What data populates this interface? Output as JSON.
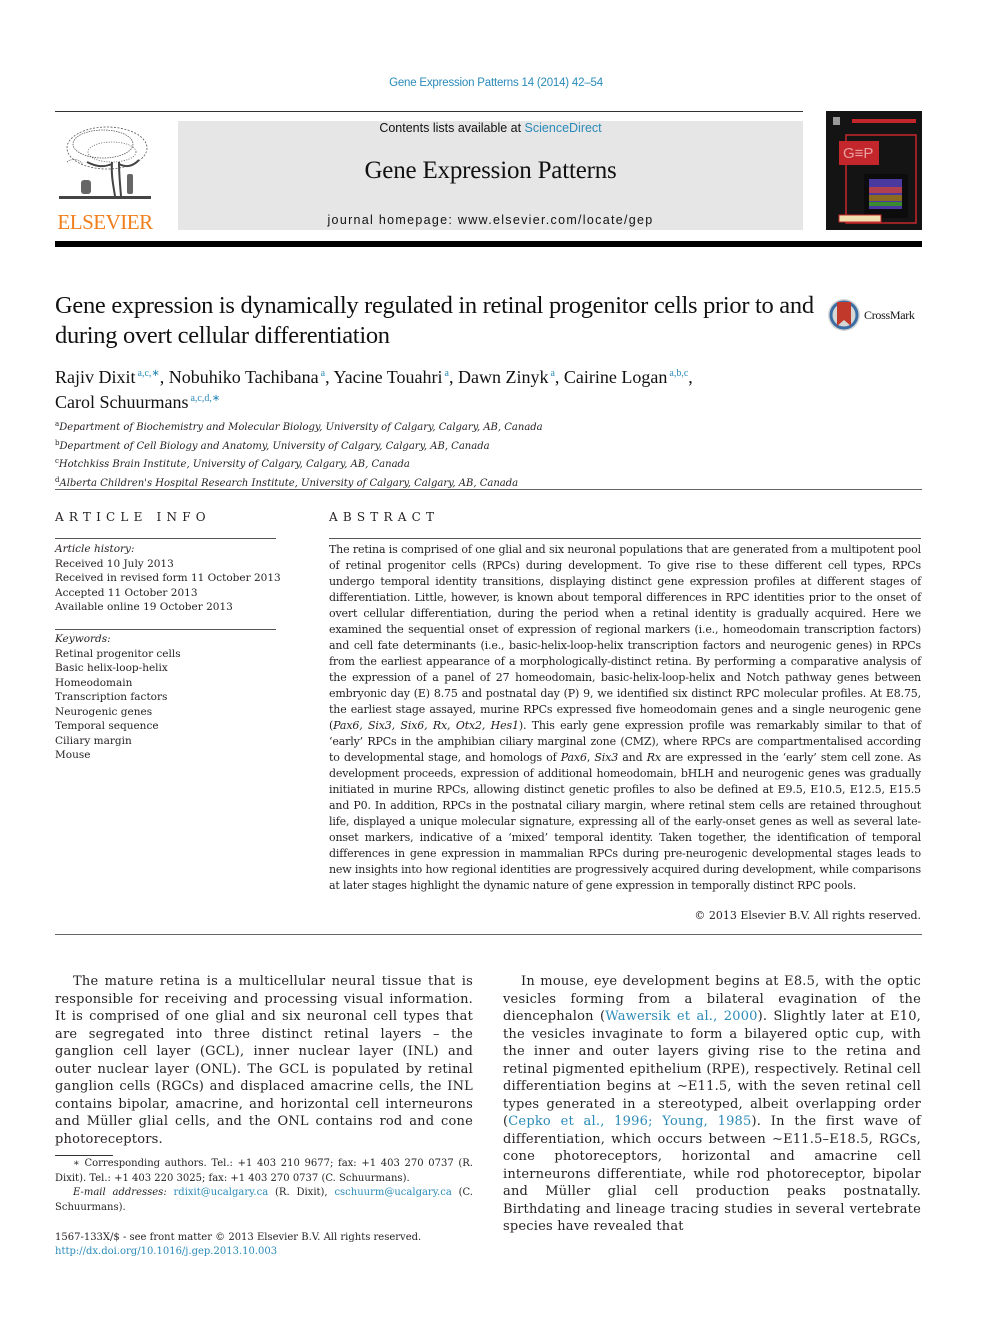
{
  "header": {
    "running_head": "Gene Expression Patterns 14 (2014) 42–54",
    "contents_prefix": "Contents lists available at ",
    "contents_link": "ScienceDirect",
    "journal_name": "Gene Expression Patterns",
    "homepage": "journal homepage: www.elsevier.com/locate/gep",
    "publisher_wordmark": "ELSEVIER",
    "crossmark_label": "CrossMark",
    "colors": {
      "link": "#2a8ab8",
      "elsevier_orange": "#f07f1d",
      "cover_red": "#c3272b",
      "banner_gray": "#e6e6e6"
    }
  },
  "article": {
    "title": "Gene expression is dynamically regulated in retinal progenitor cells prior to and during overt cellular differentiation",
    "authors": [
      {
        "name": "Rajiv Dixit",
        "sup": "a,c,∗",
        "sep": ", "
      },
      {
        "name": "Nobuhiko Tachibana",
        "sup": "a",
        "sep": ", "
      },
      {
        "name": "Yacine Touahri",
        "sup": "a",
        "sep": ", "
      },
      {
        "name": "Dawn Zinyk",
        "sup": "a",
        "sep": ", "
      },
      {
        "name": "Cairine Logan",
        "sup": "a,b,c",
        "sep": ","
      },
      {
        "name": "Carol Schuurmans",
        "sup": "a,c,d,∗",
        "sep": ""
      }
    ],
    "affiliations": [
      {
        "key": "a",
        "text": "Department of Biochemistry and Molecular Biology, University of Calgary, Calgary, AB, Canada"
      },
      {
        "key": "b",
        "text": "Department of Cell Biology and Anatomy, University of Calgary, Calgary, AB, Canada"
      },
      {
        "key": "c",
        "text": "Hotchkiss Brain Institute, University of Calgary, Calgary, AB, Canada"
      },
      {
        "key": "d",
        "text": "Alberta Children's Hospital Research Institute, University of Calgary, Calgary, AB, Canada"
      }
    ]
  },
  "article_info": {
    "heading": "ARTICLE INFO",
    "history_label": "Article history:",
    "history": [
      "Received 10 July 2013",
      "Received in revised form 11 October 2013",
      "Accepted 11 October 2013",
      "Available online 19 October 2013"
    ],
    "keywords_label": "Keywords:",
    "keywords": [
      "Retinal progenitor cells",
      "Basic helix-loop-helix",
      "Homeodomain",
      "Transcription factors",
      "Neurogenic genes",
      "Temporal sequence",
      "Ciliary margin",
      "Mouse"
    ]
  },
  "abstract": {
    "heading": "ABSTRACT",
    "part1": "The retina is comprised of one glial and six neuronal populations that are generated from a multipotent pool of retinal progenitor cells (RPCs) during development. To give rise to these different cell types, RPCs undergo temporal identity transitions, displaying distinct gene expression profiles at different stages of differentiation. Little, however, is known about temporal differences in RPC identities prior to the onset of overt cellular differentiation, during the period when a retinal identity is gradually acquired. Here we examined the sequential onset of expression of regional markers (i.e., homeodomain transcription factors) and cell fate determinants (i.e., basic-helix-loop-helix transcription factors and neurogenic genes) in RPCs from the earliest appearance of a morphologically-distinct retina. By performing a comparative analysis of the expression of a panel of 27 homeodomain, basic-helix-loop-helix and Notch pathway genes between embryonic day (E) 8.75 and postnatal day (P) 9, we identified six distinct RPC molecular profiles. At E8.75, the earliest stage assayed, murine RPCs expressed five homeodomain genes and a single neurogenic gene (",
    "genes1": "Pax6, Six3, Six6, Rx, Otx2, Hes1",
    "part2": "). This early gene expression profile was remarkably similar to that of ‘early’ RPCs in the amphibian ciliary marginal zone (CMZ), where RPCs are compartmentalised according to developmental stage, and homologs of ",
    "gene_pax6": "Pax6",
    "sep_comma": ", ",
    "gene_six3": "Six3",
    "sep_and": " and ",
    "gene_rx": "Rx",
    "part3": " are expressed in the ‘early’ stem cell zone. As development proceeds, expression of additional homeodomain, bHLH and neurogenic genes was gradually initiated in murine RPCs, allowing distinct genetic profiles to also be defined at E9.5, E10.5, E12.5, E15.5 and P0. In addition, RPCs in the postnatal ciliary margin, where retinal stem cells are retained throughout life, displayed a unique molecular signature, expressing all of the early-onset genes as well as several late-onset markers, indicative of a ‘mixed’ temporal identity. Taken together, the identification of temporal differences in gene expression in mammalian RPCs during pre-neurogenic developmental stages leads to new insights into how regional identities are progressively acquired during development, while comparisons at later stages highlight the dynamic nature of gene expression in temporally distinct RPC pools.",
    "copyright": "© 2013 Elsevier B.V. All rights reserved."
  },
  "body": {
    "left_paragraph": "The mature retina is a multicellular neural tissue that is responsible for receiving and processing visual information. It is comprised of one glial and six neuronal cell types that are segregated into three distinct retinal layers – the ganglion cell layer (GCL), inner nuclear layer (INL) and outer nuclear layer (ONL). The GCL is populated by retinal ganglion cells (RGCs) and displaced amacrine cells, the INL contains bipolar, amacrine, and horizontal cell interneurons and Müller glial cells, and the ONL contains rod and cone photoreceptors.",
    "right": {
      "t1": "In mouse, eye development begins at E8.5, with the optic vesicles forming from a bilateral evagination of the diencephalon (",
      "ref1": "Wawersik et al., 2000",
      "t2": "). Slightly later at E10, the vesicles invaginate to form a bilayered optic cup, with the inner and outer layers giving rise to the retina and retinal pigmented epithelium (RPE), respectively. Retinal cell differentiation begins at ∼E11.5, with the seven retinal cell types generated in a stereotyped, albeit overlapping order (",
      "ref2": "Cepko et al., 1996; Young, 1985",
      "t3": "). In the first wave of differentiation, which occurs between ∼E11.5–E18.5, RGCs, cone photoreceptors, horizontal and amacrine cell interneurons differentiate, while rod photoreceptor, bipolar and Müller glial cell production peaks postnatally. Birthdating and lineage tracing studies in several vertebrate species have revealed that"
    }
  },
  "footnotes": {
    "corresponding": "∗ Corresponding authors. Tel.: +1 403 210 9677; fax: +1 403 270 0737 (R. Dixit). Tel.: +1 403 220 3025; fax: +1 403 270 0737 (C. Schuurmans).",
    "email_label": "E-mail addresses:",
    "email1": "rdixit@ucalgary.ca",
    "email1_owner": " (R. Dixit), ",
    "email2": "cschuurm@ucalgary.ca",
    "email2_owner": " (C. Schuurmans).",
    "issn_line": "1567-133X/$ - see front matter © 2013 Elsevier B.V. All rights reserved.",
    "doi": "http://dx.doi.org/10.1016/j.gep.2013.10.003"
  }
}
